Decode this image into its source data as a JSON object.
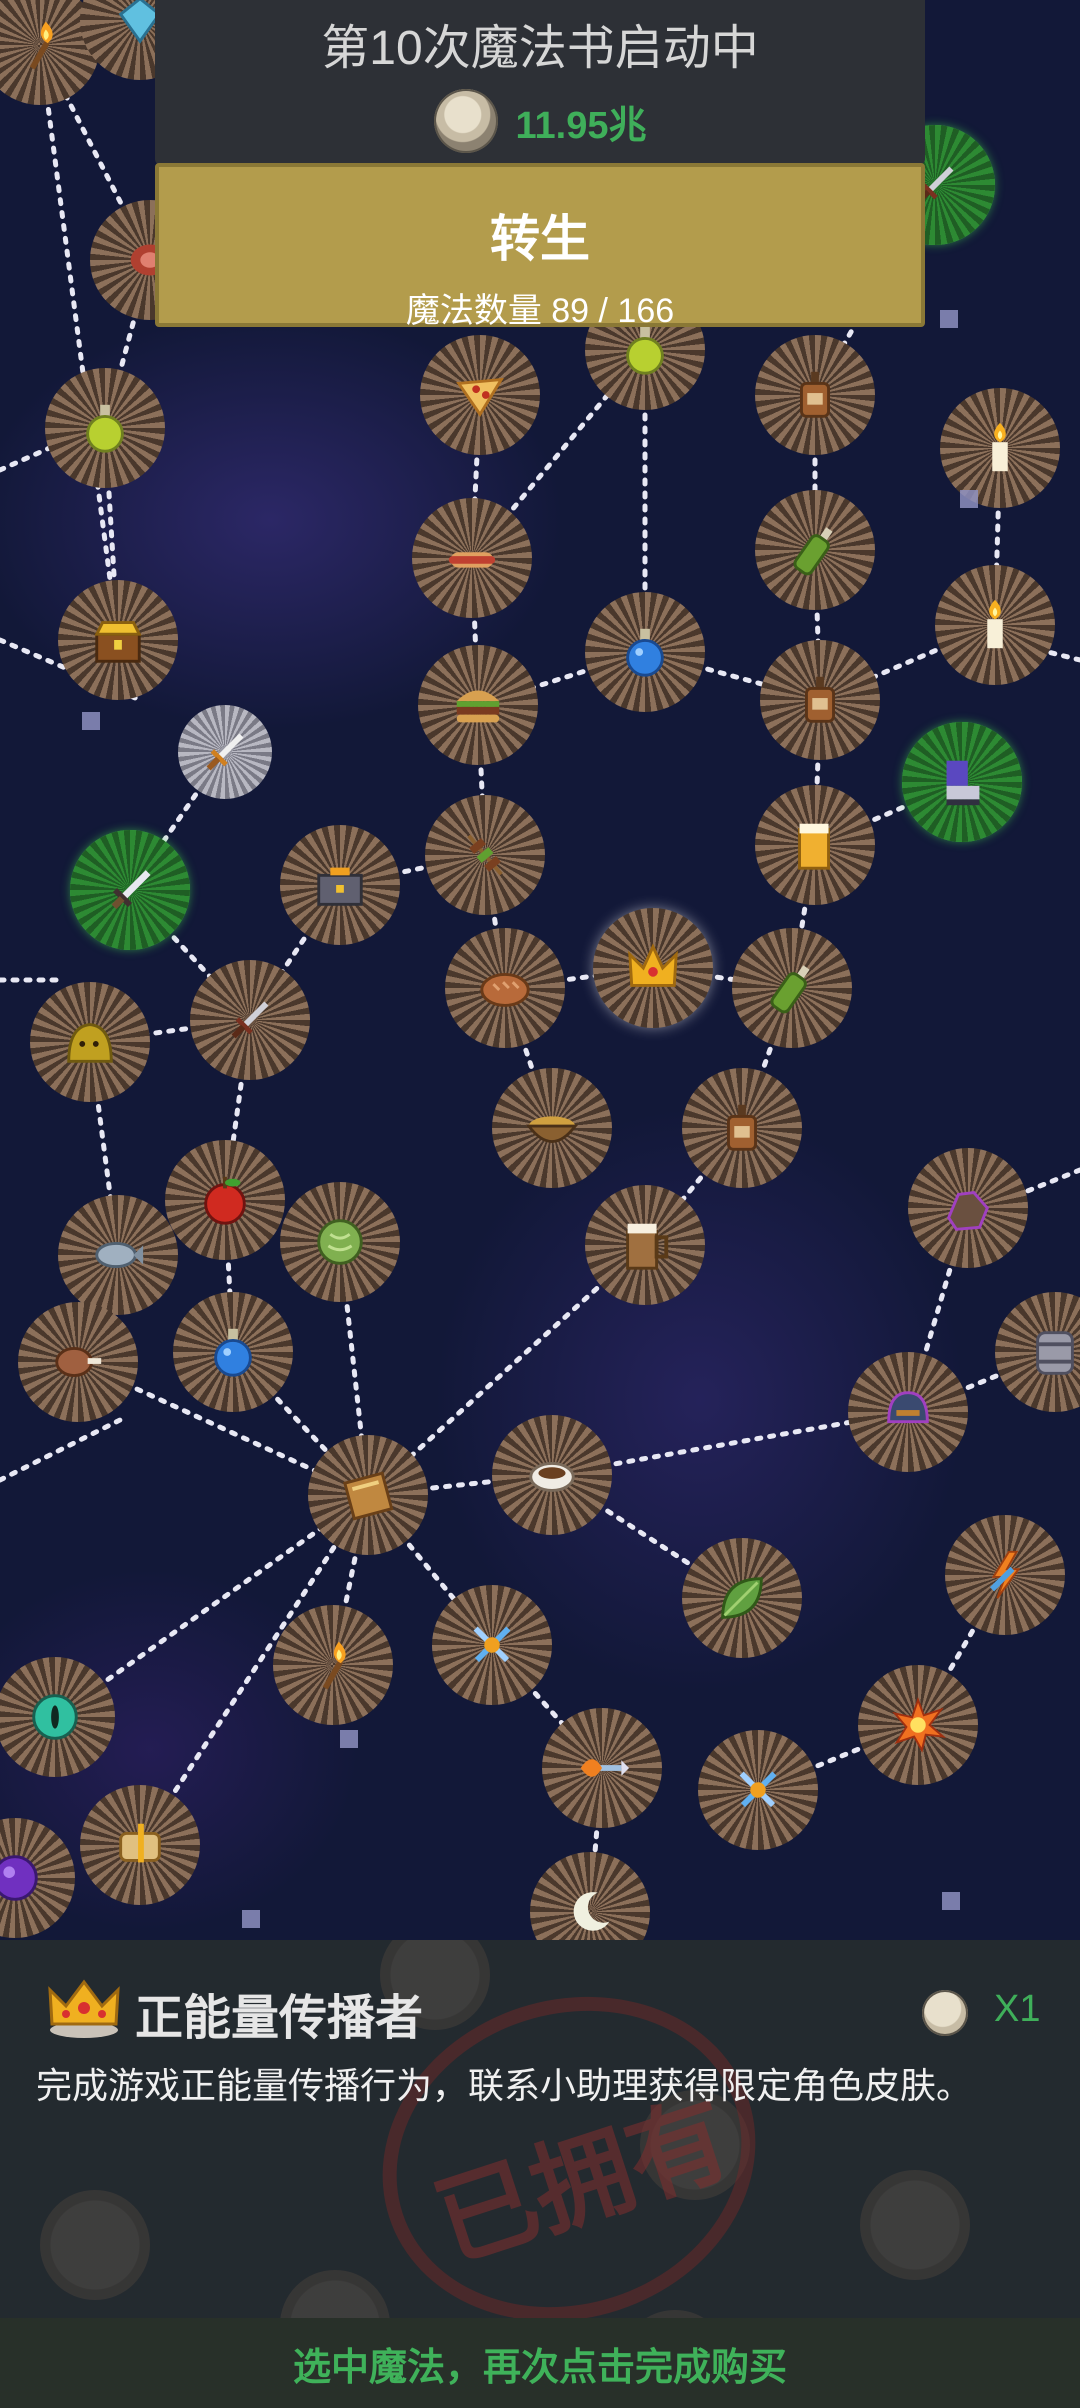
{
  "header": {
    "book_title": "第10次魔法书启动中",
    "currency_icon": "silver-coin-icon",
    "currency_amount": "11.95兆"
  },
  "rebirth": {
    "label": "转生",
    "magic_count": "魔法数量 89 / 166"
  },
  "detail": {
    "icon": "crown-icon",
    "name": "正能量传播者",
    "cost_icon": "silver-coin-icon",
    "cost": "X1",
    "description": "完成游戏正能量传播行为，联系小助理获得限定角色皮肤。",
    "owned_stamp": "已拥有"
  },
  "footer": {
    "hint": "选中魔法，再次点击完成购买"
  },
  "colors": {
    "accent_green": "#3faf5a",
    "rebirth_gold": "#b39c4c",
    "panel_dark": "#2d3036"
  },
  "nodes": [
    {
      "icon": "torch-icon",
      "state": "normal"
    },
    {
      "icon": "gem-icon",
      "state": "normal"
    },
    {
      "icon": "meat-icon",
      "state": "normal"
    },
    {
      "icon": "dagger-icon",
      "state": "green"
    },
    {
      "icon": "pizza-icon",
      "state": "normal"
    },
    {
      "icon": "green-potion-icon",
      "state": "normal"
    },
    {
      "icon": "bottle-icon",
      "state": "normal"
    },
    {
      "icon": "green-potion-icon",
      "state": "normal"
    },
    {
      "icon": "candle-icon",
      "state": "normal"
    },
    {
      "icon": "hotdog-icon",
      "state": "normal"
    },
    {
      "icon": "wine-bottle-icon",
      "state": "normal"
    },
    {
      "icon": "treasure-chest-icon",
      "state": "normal"
    },
    {
      "icon": "blue-potion-icon",
      "state": "normal"
    },
    {
      "icon": "burger-icon",
      "state": "normal"
    },
    {
      "icon": "candle-icon",
      "state": "normal"
    },
    {
      "icon": "bottle-icon",
      "state": "normal"
    },
    {
      "icon": "short-sword-icon",
      "state": "gray"
    },
    {
      "icon": "armor-boots-icon",
      "state": "green"
    },
    {
      "icon": "sword-icon",
      "state": "green"
    },
    {
      "icon": "toolbox-icon",
      "state": "normal"
    },
    {
      "icon": "kebab-icon",
      "state": "normal"
    },
    {
      "icon": "beer-icon",
      "state": "normal"
    },
    {
      "icon": "bread-icon",
      "state": "normal"
    },
    {
      "icon": "crown-icon",
      "state": "selected"
    },
    {
      "icon": "wine-bottle-icon",
      "state": "normal"
    },
    {
      "icon": "slime-icon",
      "state": "normal"
    },
    {
      "icon": "dagger-icon",
      "state": "normal"
    },
    {
      "icon": "soup-icon",
      "state": "normal"
    },
    {
      "icon": "bottle-icon",
      "state": "normal"
    },
    {
      "icon": "apple-icon",
      "state": "normal"
    },
    {
      "icon": "ore-icon",
      "state": "normal"
    },
    {
      "icon": "fish-icon",
      "state": "normal"
    },
    {
      "icon": "cabbage-icon",
      "state": "normal"
    },
    {
      "icon": "beer-mug-icon",
      "state": "normal"
    },
    {
      "icon": "drumstick-icon",
      "state": "normal"
    },
    {
      "icon": "blue-potion-icon",
      "state": "normal"
    },
    {
      "icon": "barrel-icon",
      "state": "normal"
    },
    {
      "icon": "helmet-icon",
      "state": "normal"
    },
    {
      "icon": "spellbook-icon",
      "state": "normal"
    },
    {
      "icon": "coffee-icon",
      "state": "normal"
    },
    {
      "icon": "leaf-icon",
      "state": "normal"
    },
    {
      "icon": "lightning-arrow-icon",
      "state": "normal"
    },
    {
      "icon": "torch-icon",
      "state": "normal"
    },
    {
      "icon": "crossed-swords-icon",
      "state": "normal"
    },
    {
      "icon": "eye-orb-icon",
      "state": "normal"
    },
    {
      "icon": "explosion-icon",
      "state": "normal"
    },
    {
      "icon": "fire-arrow-icon",
      "state": "normal"
    },
    {
      "icon": "crossed-swords-icon",
      "state": "normal"
    },
    {
      "icon": "purple-orb-icon",
      "state": "normal"
    },
    {
      "icon": "scroll-icon",
      "state": "normal"
    },
    {
      "icon": "moon-icon",
      "state": "dark"
    }
  ]
}
